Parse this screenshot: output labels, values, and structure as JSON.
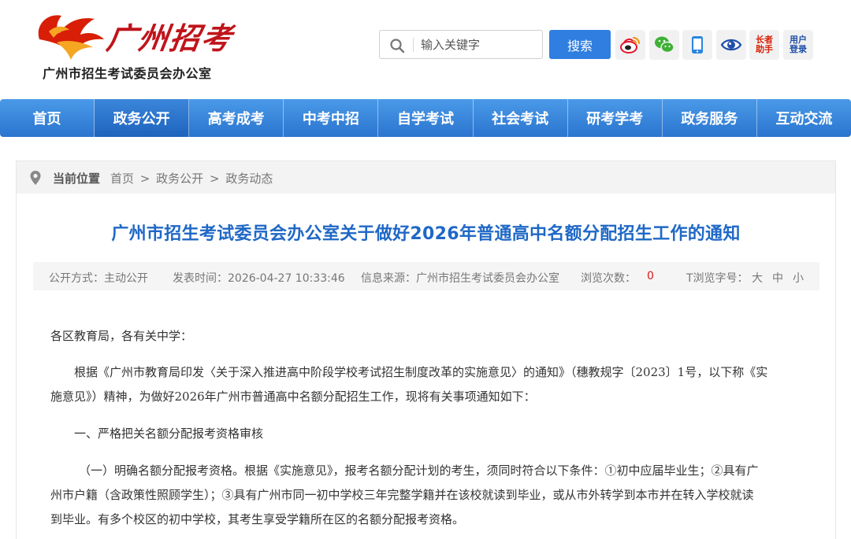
{
  "header": {
    "logo_text": "广州招考",
    "org_name": "广州市招生考试委员会办公室",
    "search_placeholder": "输入关键字",
    "search_button": "搜索",
    "social": [
      {
        "icon": "weibo-icon",
        "label": ""
      },
      {
        "icon": "wechat-icon",
        "label": ""
      },
      {
        "icon": "mobile-icon",
        "label": ""
      },
      {
        "icon": "eye-icon",
        "label": ""
      },
      {
        "icon": "elder-helper-icon",
        "label": "长者\n助手"
      },
      {
        "icon": "user-login-icon",
        "label": "用户\n登录"
      }
    ]
  },
  "nav": {
    "items": [
      "首页",
      "政务公开",
      "高考成考",
      "中考中招",
      "自学考试",
      "社会考试",
      "研考学考",
      "政务服务",
      "互动交流"
    ],
    "active_index": 1
  },
  "breadcrumb": {
    "label": "当前位置",
    "path": [
      "首页",
      ">",
      "政务公开",
      ">",
      "政务动态"
    ]
  },
  "article": {
    "title": "广州市招生考试委员会办公室关于做好2026年普通高中名额分配招生工作的通知",
    "meta": {
      "open_mode": "公开方式：主动公开",
      "publish_time": "发表时间：2026-04-27 10:33:46",
      "source": "信息来源：广州市招生考试委员会办公室",
      "views_label": "浏览次数：",
      "views_count": "0",
      "font_size_label": "T浏览字号：",
      "font_large": "大",
      "font_medium": "中",
      "font_small": "小"
    },
    "paragraphs": [
      [
        "各区教育局，各有关中学："
      ],
      [
        "根据《广州市教育局印发〈关于深入推进高中阶段学校考试招生制度改革的实施意见〉的通知》（穗教规字〔2023〕1号，以下称《实",
        "施意见》）精神，为做好2026年广州市普通高中名额分配招生工作，现将有关事项通知如下："
      ],
      [
        "一、严格把关名额分配报考资格审核"
      ],
      [
        "（一）明确名额分配报考资格。根据《实施意见》，报考名额分配计划的考生，须同时符合以下条件：①初中应届毕业生；②具有广",
        "州市户籍（含政策性照顾学生）；③具有广州市同一初中学校三年完整学籍并在该校就读到毕业，或从市外转学到本市并在转入学校就读",
        "到毕业。有多个校区的初中学校，其考生享受学籍所在区的名额分配报考资格。"
      ]
    ]
  },
  "colors": {
    "nav_blue": "#2f7ee0",
    "title_blue": "#1f68c6",
    "logo_red": "#c0141b",
    "count_red": "#e0141b"
  }
}
